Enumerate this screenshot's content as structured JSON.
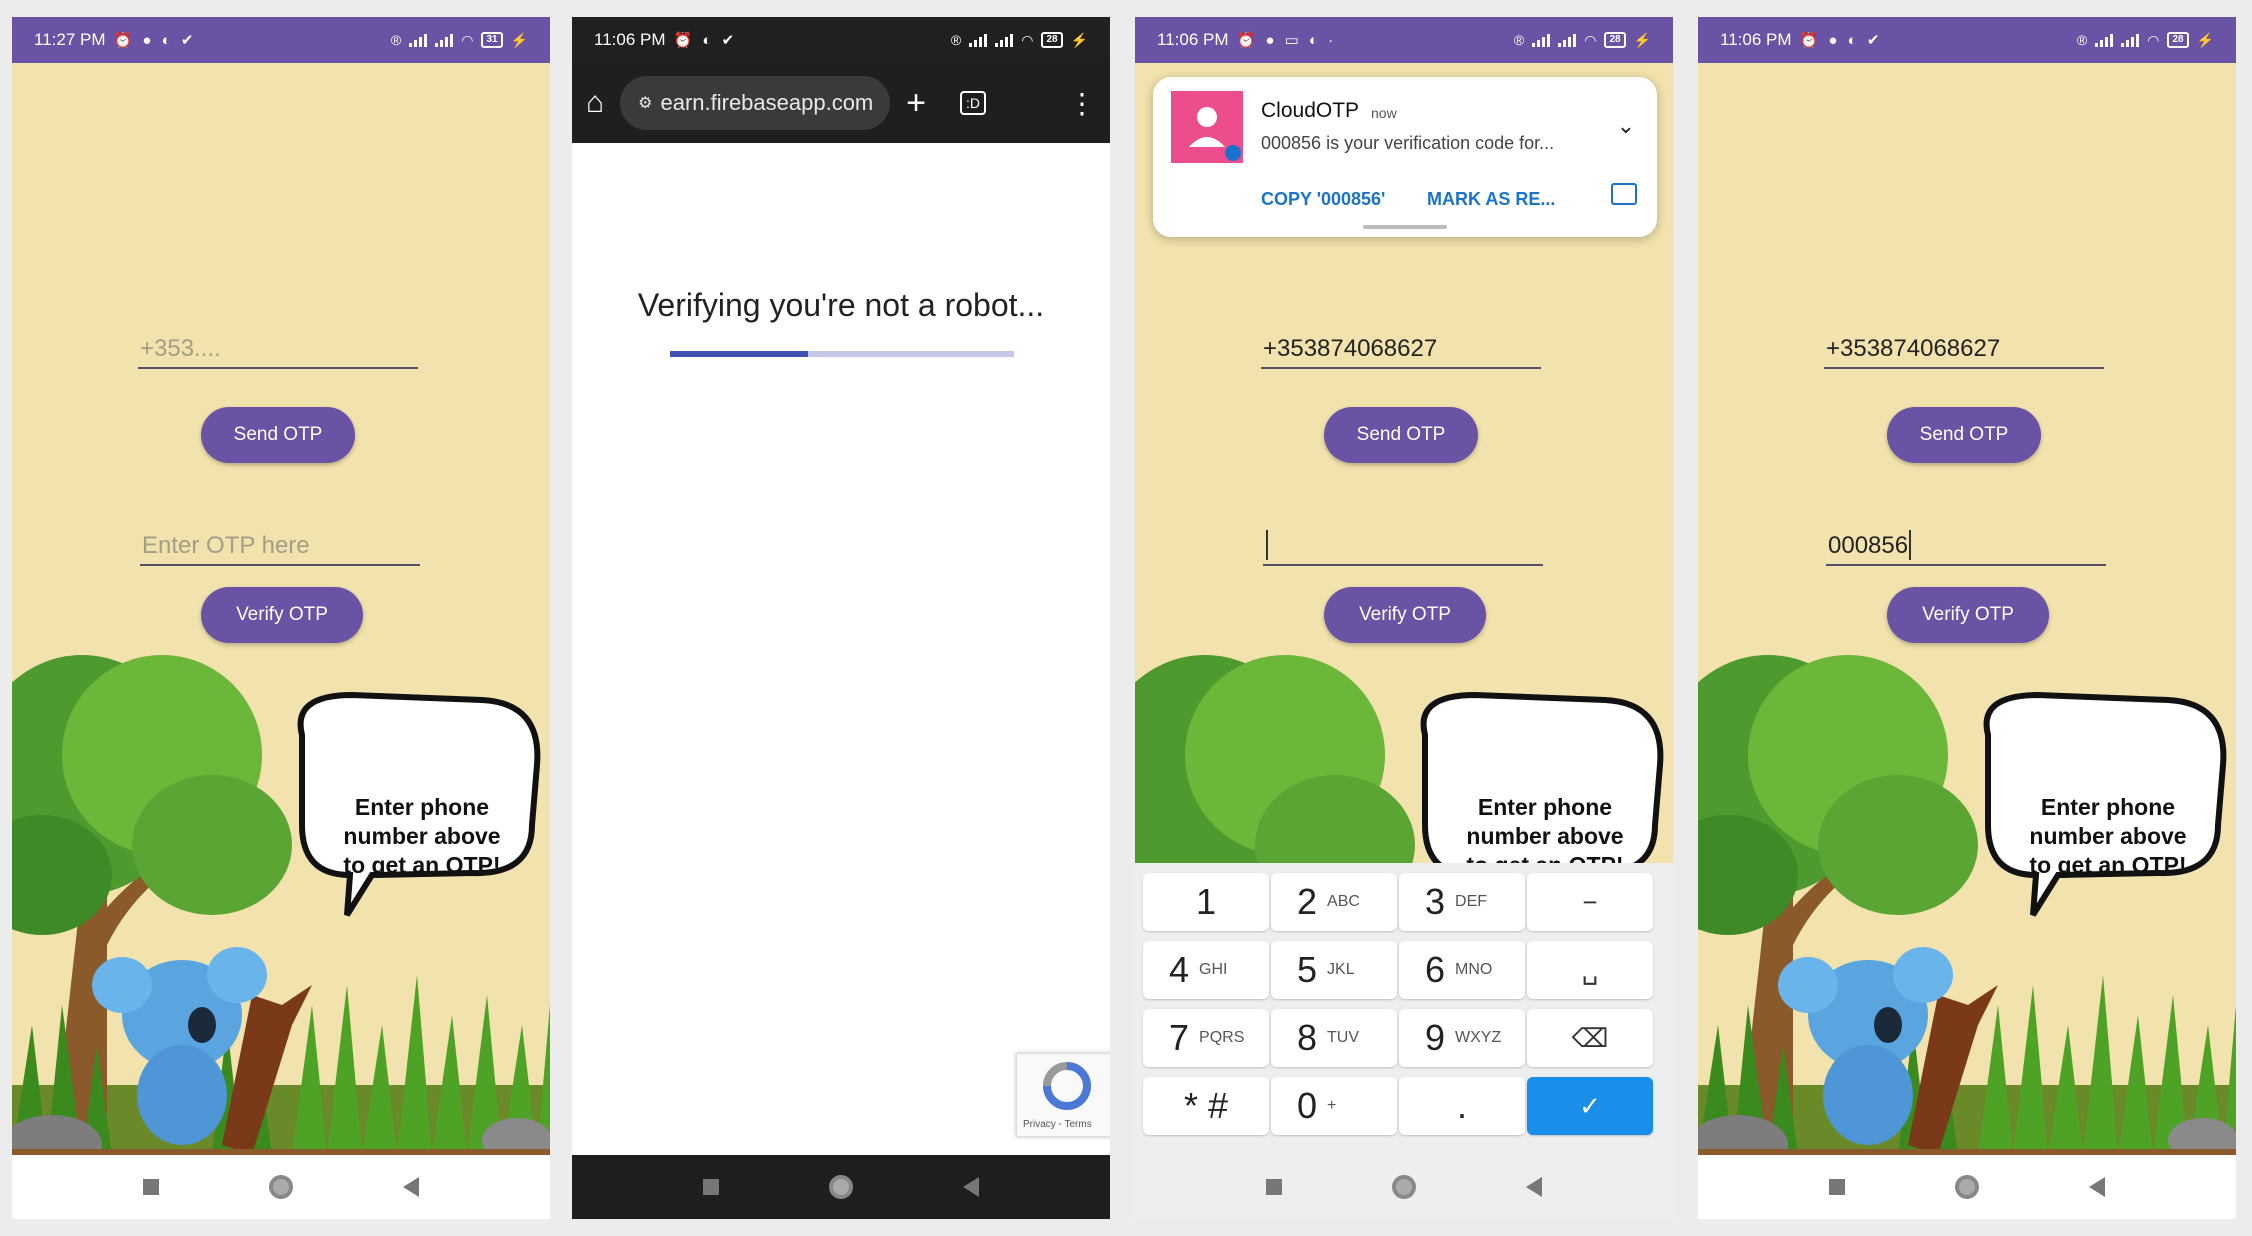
{
  "screens": [
    {
      "status_time": "11:27 PM",
      "battery": "31",
      "phone_placeholder": "+353....",
      "send_label": "Send OTP",
      "otp_placeholder": "Enter OTP here",
      "verify_label": "Verify OTP",
      "bubble_text": [
        "Enter phone",
        "number above",
        "to get an OTP!"
      ]
    },
    {
      "status_time": "11:06 PM",
      "battery": "28",
      "url": "earn.firebaseapp.com",
      "tab_count": ":D",
      "verifying_text": "Verifying you're not a robot...",
      "progress": 0.4,
      "recaptcha_text": "Privacy - Terms"
    },
    {
      "status_time": "11:06 PM",
      "battery": "28",
      "notification": {
        "app": "CloudOTP",
        "time": "now",
        "body": "000856 is your verification code for...",
        "action_copy": "COPY '000856'",
        "action_read": "MARK AS RE..."
      },
      "phone_value": "+353874068627",
      "send_label": "Send OTP",
      "verify_label": "Verify OTP",
      "bubble_text": [
        "Enter phone",
        "number above",
        "to get an OTP!"
      ],
      "keypad": [
        {
          "num": "1",
          "letters": ""
        },
        {
          "num": "2",
          "letters": "ABC"
        },
        {
          "num": "3",
          "letters": "DEF"
        },
        {
          "num": "−",
          "letters": ""
        },
        {
          "num": "4",
          "letters": "GHI"
        },
        {
          "num": "5",
          "letters": "JKL"
        },
        {
          "num": "6",
          "letters": "MNO"
        },
        {
          "num": "␣",
          "letters": ""
        },
        {
          "num": "7",
          "letters": "PQRS"
        },
        {
          "num": "8",
          "letters": "TUV"
        },
        {
          "num": "9",
          "letters": "WXYZ"
        },
        {
          "num": "⌫",
          "letters": ""
        },
        {
          "num": "* #",
          "letters": ""
        },
        {
          "num": "0",
          "letters": "+"
        },
        {
          "num": ".",
          "letters": ""
        },
        {
          "num": "✓",
          "letters": ""
        }
      ]
    },
    {
      "status_time": "11:06 PM",
      "battery": "28",
      "phone_value": "+353874068627",
      "send_label": "Send OTP",
      "otp_value": "000856",
      "verify_label": "Verify OTP",
      "bubble_text": [
        "Enter phone",
        "number above",
        "to get an OTP!"
      ]
    }
  ],
  "colors": {
    "app_background": "#f2e2ad",
    "primary": "#6a53a4",
    "notification_action": "#1a73c8",
    "keypad_done": "#1a8ee8"
  }
}
